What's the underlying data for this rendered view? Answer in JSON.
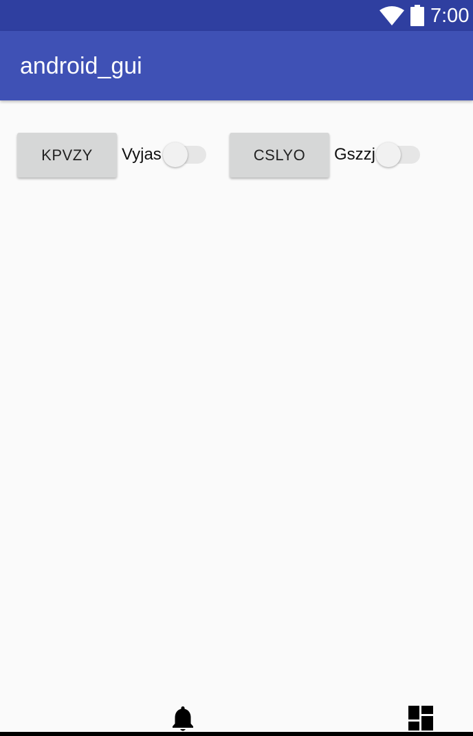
{
  "status_bar": {
    "time": "7:00",
    "icons": [
      "wifi-icon",
      "battery-icon"
    ],
    "background_color": "#2f3fa0"
  },
  "app_bar": {
    "title": "android_gui",
    "background_color": "#3f51b5"
  },
  "controls": [
    {
      "button_label": "KPVZY",
      "switch_label": "Vyjas",
      "switch_on": false
    },
    {
      "button_label": "CSLYO",
      "switch_label": "Gszzj",
      "switch_on": false
    }
  ],
  "bottom_icons": [
    "bell-icon",
    "dashboard-icon"
  ]
}
